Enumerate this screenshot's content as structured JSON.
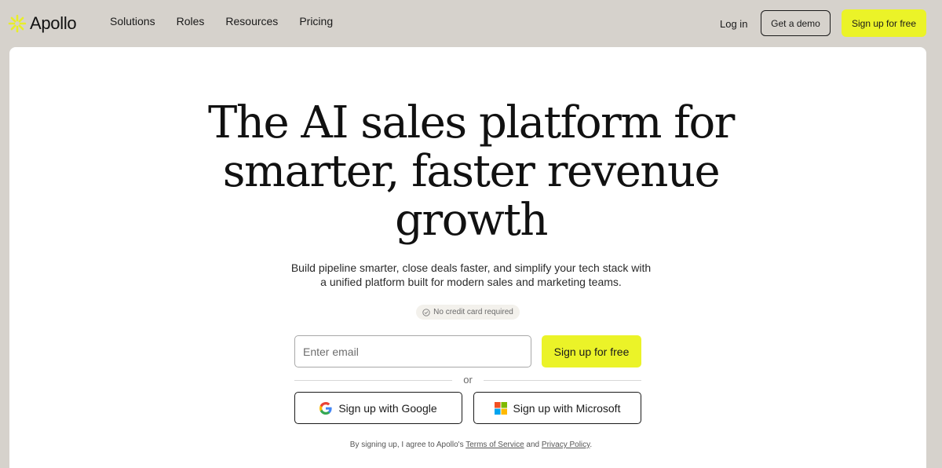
{
  "nav": {
    "brand": "Apollo",
    "links": [
      "Solutions",
      "Roles",
      "Resources",
      "Pricing"
    ],
    "login": "Log in",
    "demo": "Get a demo",
    "signup": "Sign up for free"
  },
  "hero": {
    "headline_lines": [
      "The AI sales platform for",
      "smarter, faster revenue",
      "growth"
    ],
    "subtitle_lines": [
      "Build pipeline smarter, close deals faster, and simplify your tech stack with",
      "a unified platform built for modern sales and marketing teams."
    ],
    "badge": "No credit card required"
  },
  "form": {
    "email_placeholder": "Enter email",
    "signup_label": "Sign up for free",
    "or_label": "or",
    "google_label": "Sign up with Google",
    "microsoft_label": "Sign up with Microsoft"
  },
  "legal": {
    "prefix": "By signing up, I agree to Apollo's ",
    "terms": "Terms of Service",
    "middle": " and ",
    "privacy": "Privacy Policy",
    "suffix": "."
  },
  "colors": {
    "accent": "#ebf328",
    "page_bg": "#d6d2cc",
    "card_bg": "#ffffff"
  },
  "icons": {
    "logo": "apollo-asterisk-icon",
    "badge": "check-circle-icon",
    "google": "google-icon",
    "microsoft": "microsoft-icon"
  }
}
